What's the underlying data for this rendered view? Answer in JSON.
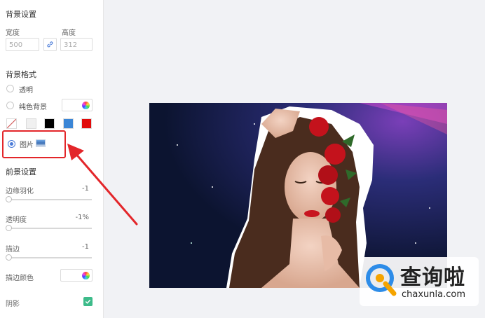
{
  "sidebar": {
    "bg_settings_title": "背景设置",
    "width_label": "宽度",
    "height_label": "高度",
    "width_placeholder": "500",
    "height_placeholder": "312",
    "bg_format_title": "背景格式",
    "opt_transparent": "透明",
    "opt_solid": "纯色背景",
    "opt_image": "图片",
    "swatches": [
      "#f0f0f0",
      "#000000",
      "#3b86d6",
      "#e10b0b"
    ],
    "fg_settings_title": "前景设置",
    "feather_label": "边缘羽化",
    "feather_value": "-1",
    "opacity_label": "透明度",
    "opacity_value": "-1%",
    "stroke_label": "描边",
    "stroke_value": "-1",
    "stroke_color_label": "描边颜色",
    "shadow_label": "阴影"
  },
  "watermark": {
    "brand": "查询啦",
    "domain": "chaxunla.com"
  },
  "colors": {
    "accent": "#4a7bd8",
    "highlight": "#e3262a",
    "check": "#3dbb8a"
  }
}
